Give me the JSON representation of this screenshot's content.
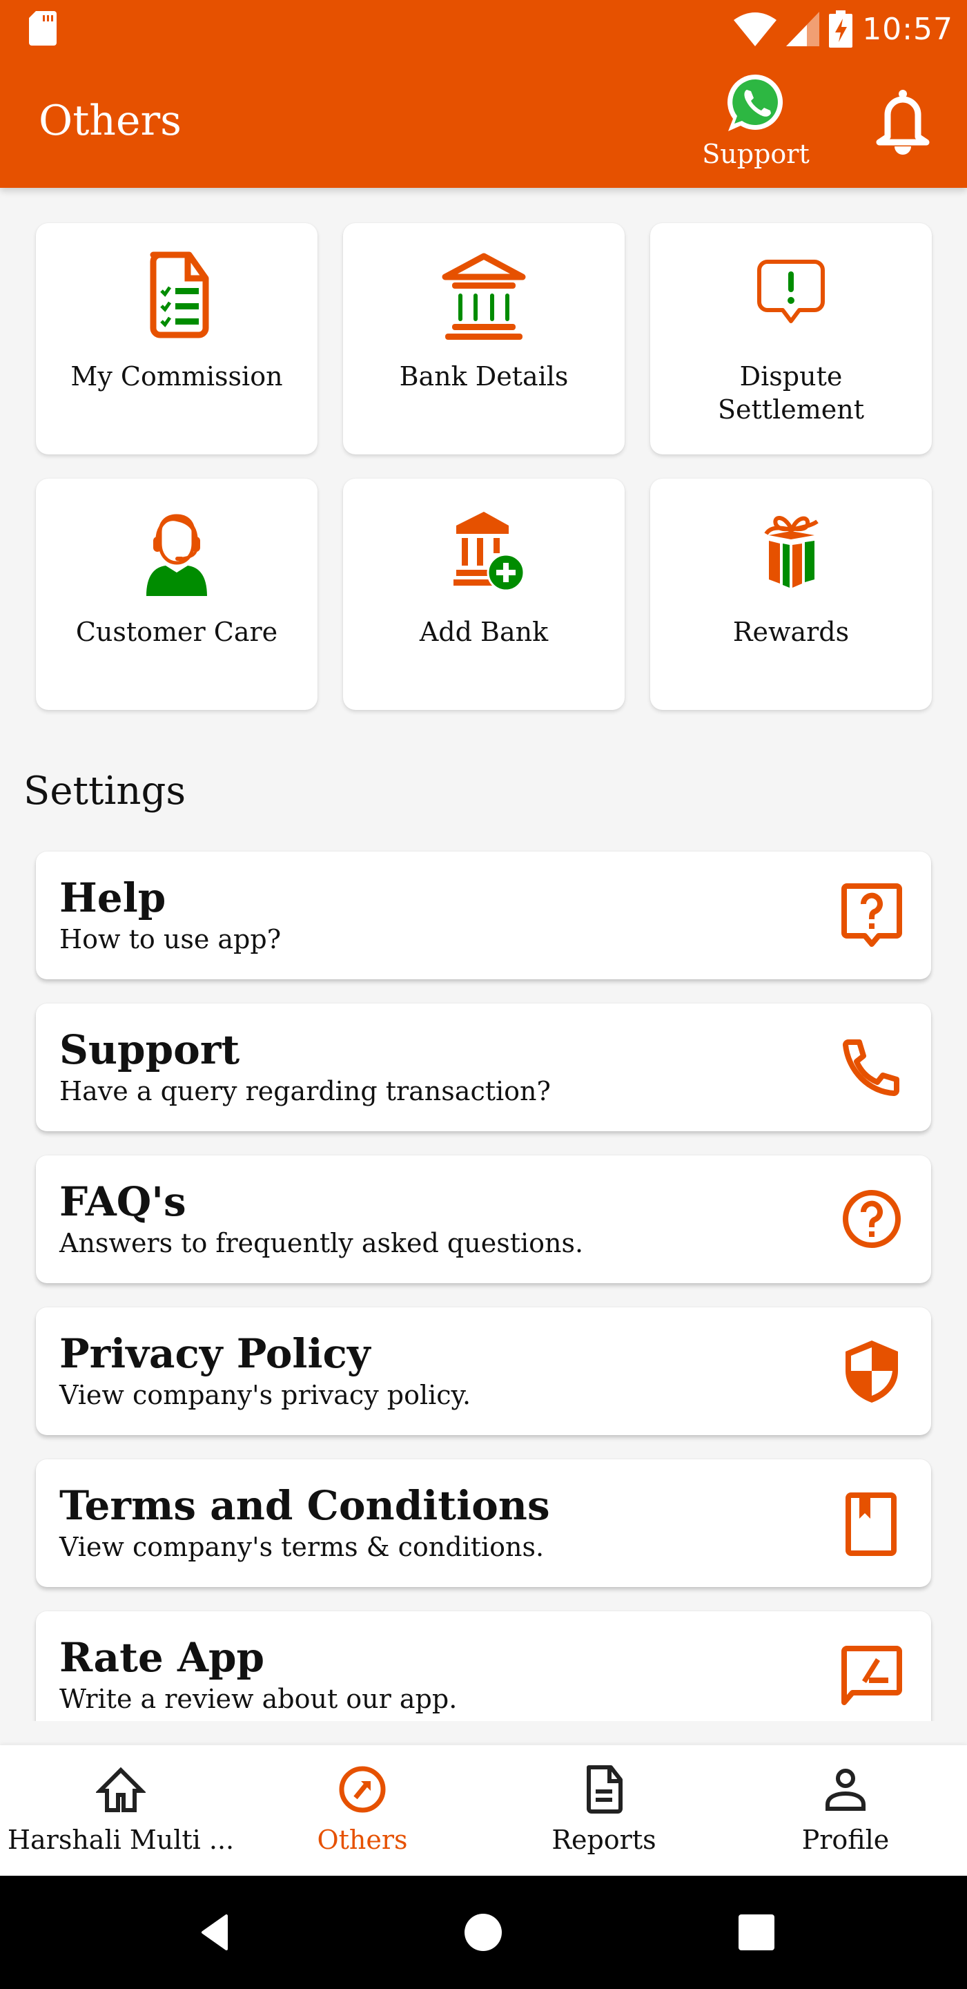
{
  "status_bar": {
    "time": "10:57",
    "icons": [
      "sd-card-icon",
      "wifi-icon",
      "cell-signal-icon",
      "battery-charging-icon"
    ]
  },
  "app_bar": {
    "title": "Others",
    "whatsapp_label": "Support",
    "whatsapp_icon": "whatsapp-icon",
    "notification_icon": "bell-icon"
  },
  "tiles": [
    {
      "label": "My Commission",
      "icon": "checklist-document-icon"
    },
    {
      "label": "Bank Details",
      "icon": "bank-icon"
    },
    {
      "label": "Dispute Settlement",
      "icon": "alert-message-icon"
    },
    {
      "label": "Customer Care",
      "icon": "headset-agent-icon"
    },
    {
      "label": "Add Bank",
      "icon": "bank-add-icon"
    },
    {
      "label": "Rewards",
      "icon": "gift-icon"
    }
  ],
  "settings": {
    "title": "Settings",
    "items": [
      {
        "title": "Help",
        "subtitle": "How to use app?",
        "icon": "help-bubble-icon"
      },
      {
        "title": "Support",
        "subtitle": "Have a query regarding transaction?",
        "icon": "phone-icon"
      },
      {
        "title": "FAQ's",
        "subtitle": "Answers to frequently asked questions.",
        "icon": "question-circle-icon"
      },
      {
        "title": "Privacy Policy",
        "subtitle": "View company's privacy policy.",
        "icon": "shield-icon"
      },
      {
        "title": "Terms and Conditions",
        "subtitle": "View company's terms & conditions.",
        "icon": "book-bookmark-icon"
      },
      {
        "title": "Rate App",
        "subtitle": "Write a review about our app.",
        "icon": "rate-review-icon"
      }
    ]
  },
  "bottom_nav": {
    "items": [
      {
        "label": "Harshali Multi ...",
        "icon": "home-icon",
        "active": false
      },
      {
        "label": "Others",
        "icon": "explore-arrow-icon",
        "active": true
      },
      {
        "label": "Reports",
        "icon": "document-icon",
        "active": false
      },
      {
        "label": "Profile",
        "icon": "person-icon",
        "active": false
      }
    ]
  },
  "system_nav": [
    "back-icon",
    "home-circle-icon",
    "recents-icon"
  ],
  "colors": {
    "primary": "#E65100",
    "accent_green": "#008C00",
    "background": "#F5F5F5",
    "card": "#FFFFFF"
  }
}
